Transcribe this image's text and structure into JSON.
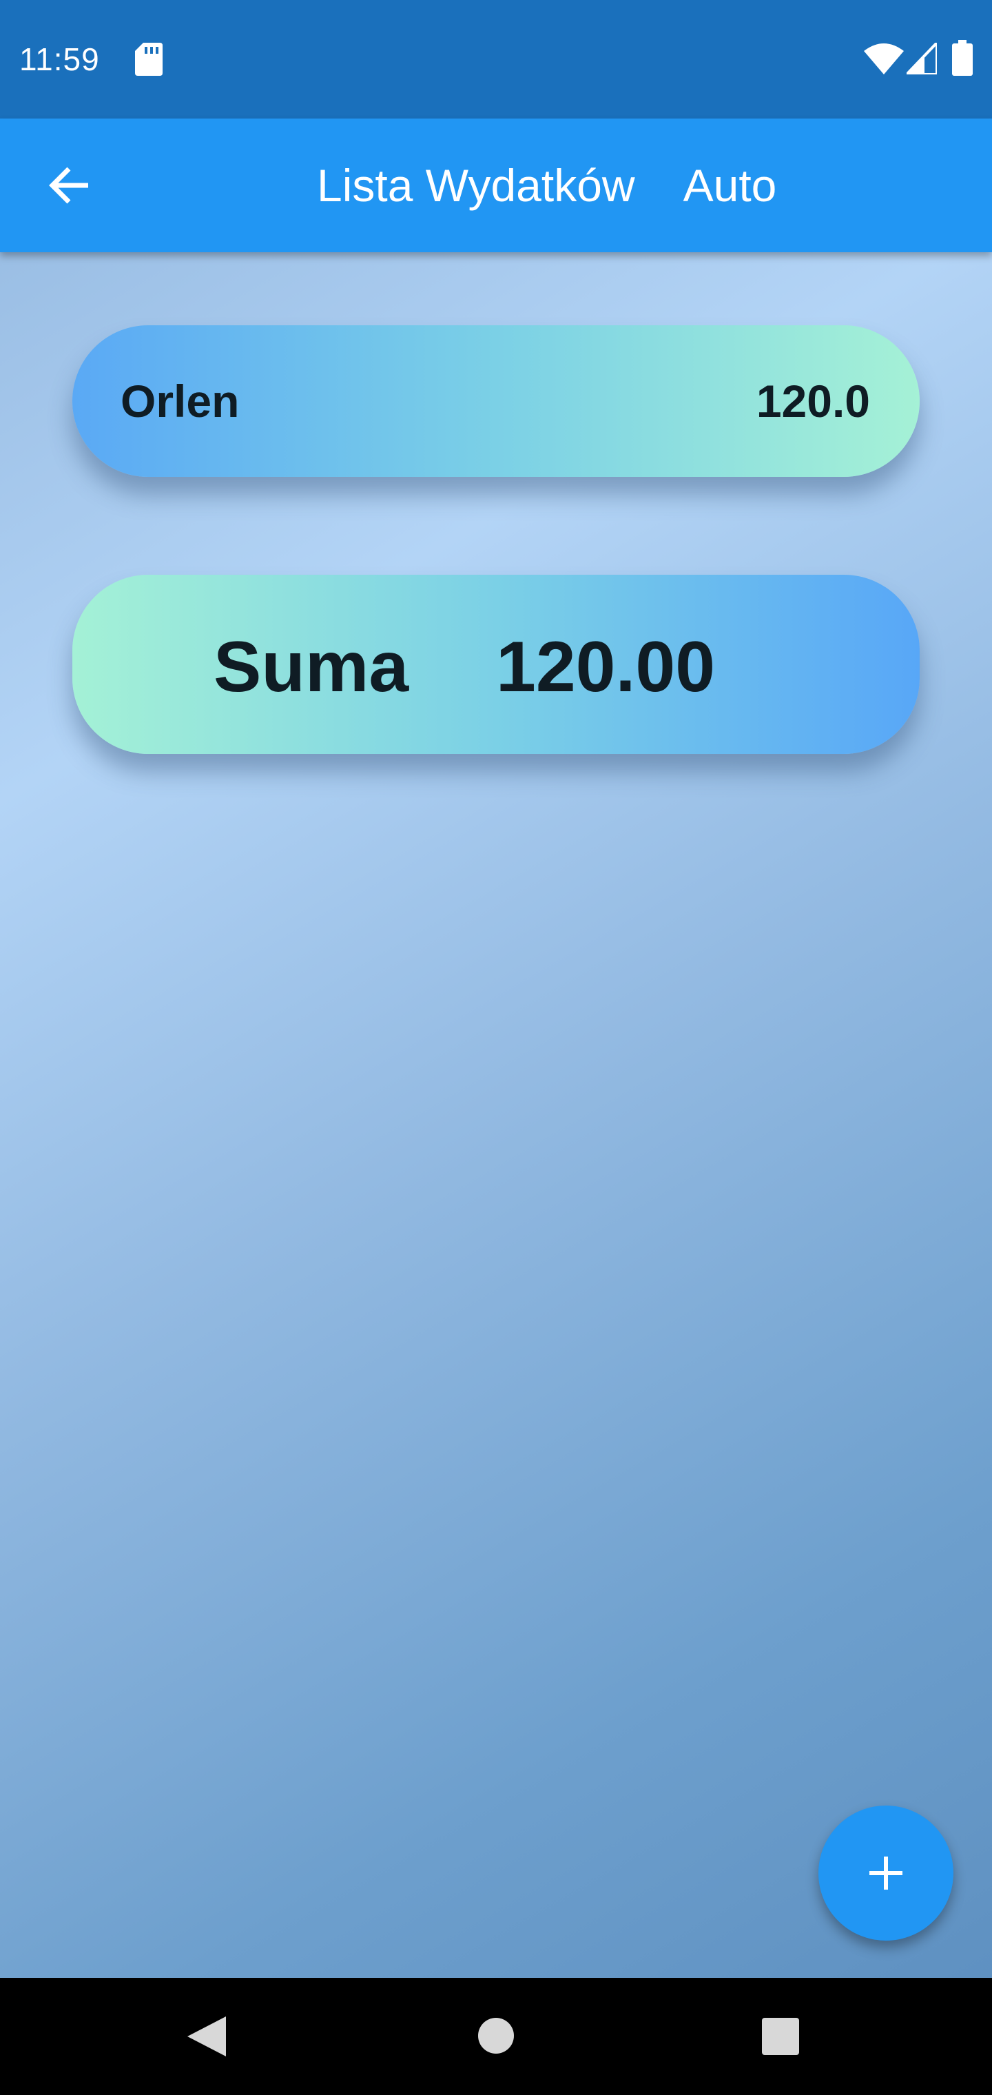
{
  "status_bar": {
    "time": "11:59",
    "icons": [
      "sd-card-icon",
      "wifi-icon",
      "cell-signal-icon",
      "battery-icon"
    ]
  },
  "app_bar": {
    "back_icon": "arrow-back-icon",
    "title": "Lista Wydatków",
    "category": "Auto"
  },
  "expenses": [
    {
      "name": "Orlen",
      "amount": "120.0"
    }
  ],
  "summary": {
    "label": "Suma",
    "value": "120.00"
  },
  "fab": {
    "icon": "plus-icon"
  },
  "nav_bar": {
    "icons": [
      "nav-back-icon",
      "nav-home-icon",
      "nav-recents-icon"
    ]
  },
  "colors": {
    "status_bar": "#1a70bc",
    "app_bar": "#2196f3",
    "fab": "#2196f3",
    "card_blue": "#5aa9f5",
    "card_mint": "#a5f1d6",
    "text_dark": "#0f1c24"
  }
}
